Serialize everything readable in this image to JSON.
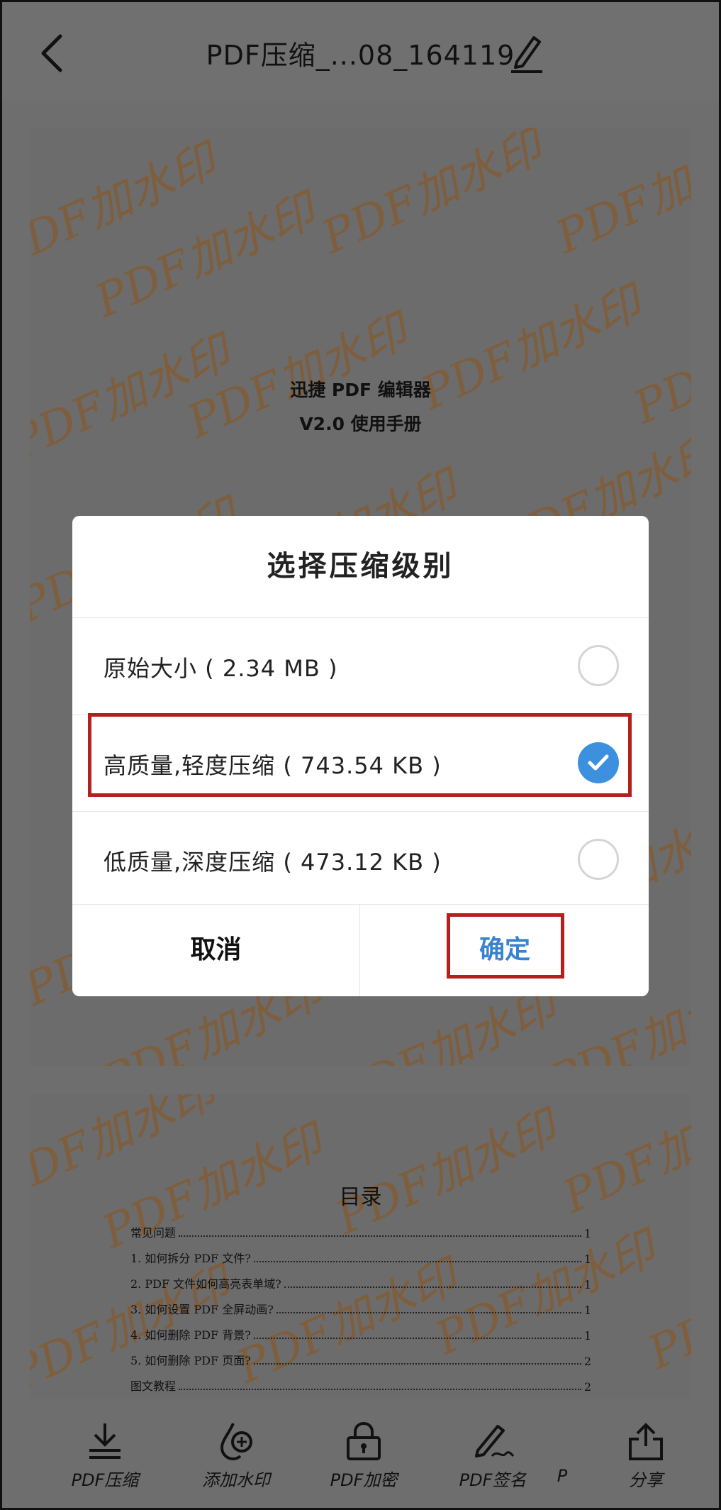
{
  "header": {
    "title": "PDF压缩_...08_164119"
  },
  "page1": {
    "doc_title": "迅捷 PDF 编辑器",
    "doc_subtitle": "V2.0 使用手册",
    "watermark": "PDF加水印"
  },
  "page2": {
    "toc_title": "目录",
    "toc": [
      {
        "text": "常见问题",
        "page": "1"
      },
      {
        "text": "1.  如何拆分 PDF 文件?",
        "page": "1"
      },
      {
        "text": "2.  PDF 文件如何高亮表单域?",
        "page": "1"
      },
      {
        "text": "3.  如何设置 PDF 全屏动画?",
        "page": "1"
      },
      {
        "text": "4.  如何删除 PDF 背景?",
        "page": "1"
      },
      {
        "text": "5.  如何删除 PDF 页面?",
        "page": "2"
      },
      {
        "text": "图文教程",
        "page": "2"
      }
    ]
  },
  "dialog": {
    "title": "选择压缩级别",
    "options": [
      {
        "label": "原始大小 ( 2.34 MB )",
        "selected": false
      },
      {
        "label": "高质量,轻度压缩 ( 743.54 KB )",
        "selected": true
      },
      {
        "label": "低质量,深度压缩 ( 473.12 KB )",
        "selected": false
      }
    ],
    "cancel_label": "取消",
    "confirm_label": "确定"
  },
  "toolbar": {
    "items": [
      {
        "label": "PDF压缩",
        "icon": "download-icon"
      },
      {
        "label": "添加水印",
        "icon": "drop-plus-icon"
      },
      {
        "label": "PDF加密",
        "icon": "lock-icon"
      },
      {
        "label": "PDF签名",
        "icon": "signature-pen-icon"
      },
      {
        "label": "P"
      },
      {
        "label": "分享",
        "icon": "share-icon"
      }
    ]
  },
  "colors": {
    "accent_blue": "#3d90de",
    "highlight_red": "#b71f1f",
    "watermark_brown": "#7f5e3b",
    "overlay_gray": "#6e6e6e"
  }
}
